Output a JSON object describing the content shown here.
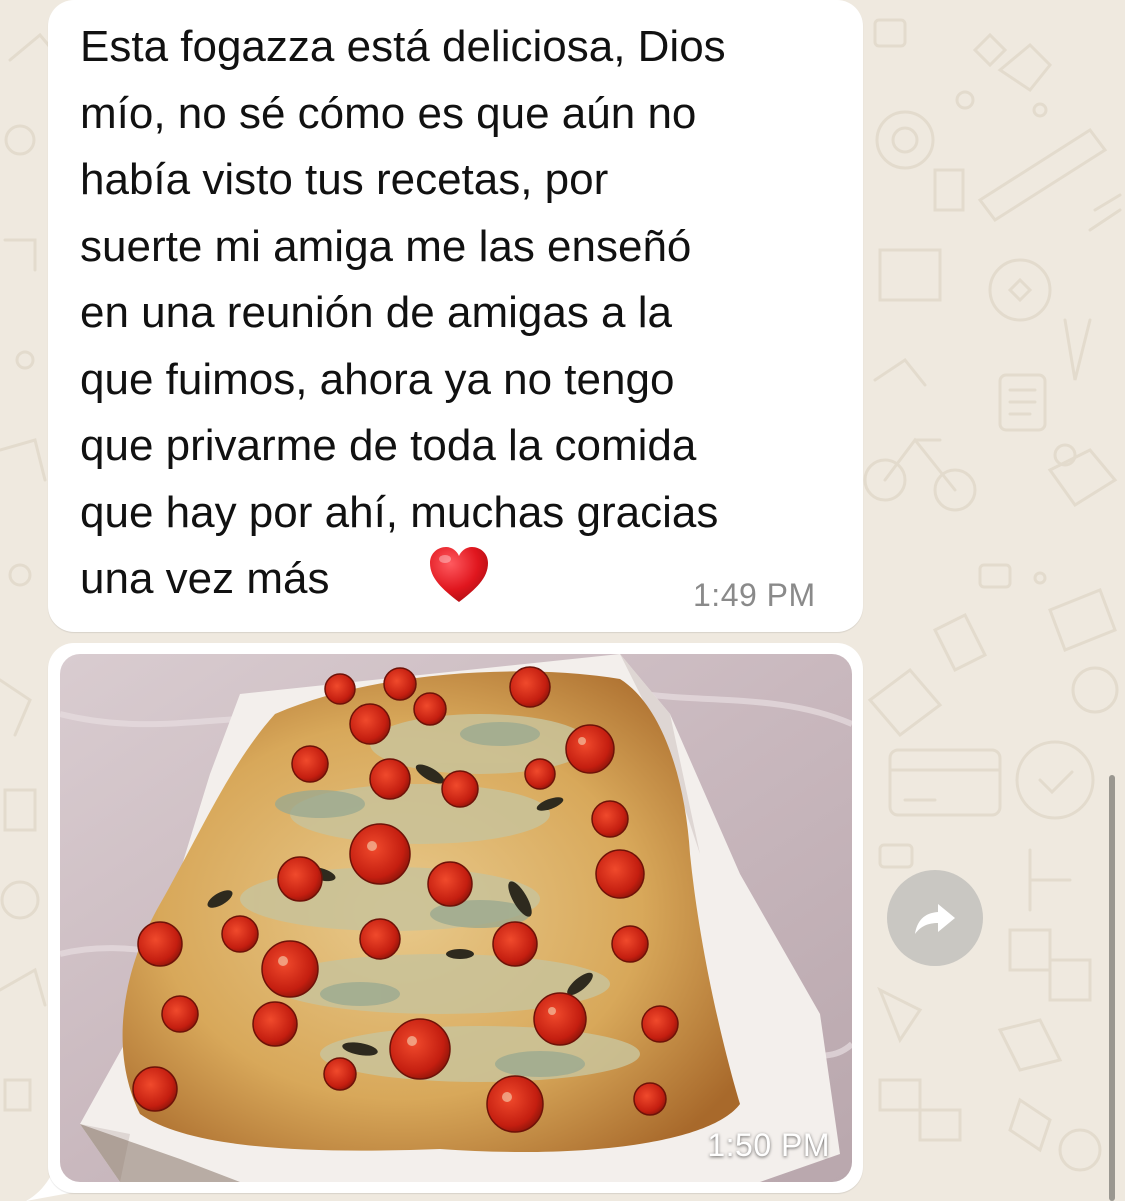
{
  "conversation": {
    "messages": [
      {
        "type": "text",
        "text": "Esta fogazza está deliciosa, Dios\nmío, no sé cómo es que aún no\nhabía visto tus recetas, por\nsuerte mi amiga me las enseñó\nen una reunión de amigas a la\nque fuimos, ahora ya no tengo\nque privarme de toda la comida\nque hay por ahí, muchas gracias\nuna vez más",
        "emoji": "red-heart",
        "time": "1:49 PM"
      },
      {
        "type": "image",
        "image_subject": "fogazza-tomato-cheese",
        "time": "1:50 PM"
      }
    ]
  },
  "forward_button": {
    "icon": "forward-arrow-icon"
  },
  "colors": {
    "chat_background": "#efe9df",
    "bubble": "#ffffff",
    "timestamp": "#8a8a8a",
    "forward_button": "#c9c7c2",
    "heart": "#e0161e"
  }
}
